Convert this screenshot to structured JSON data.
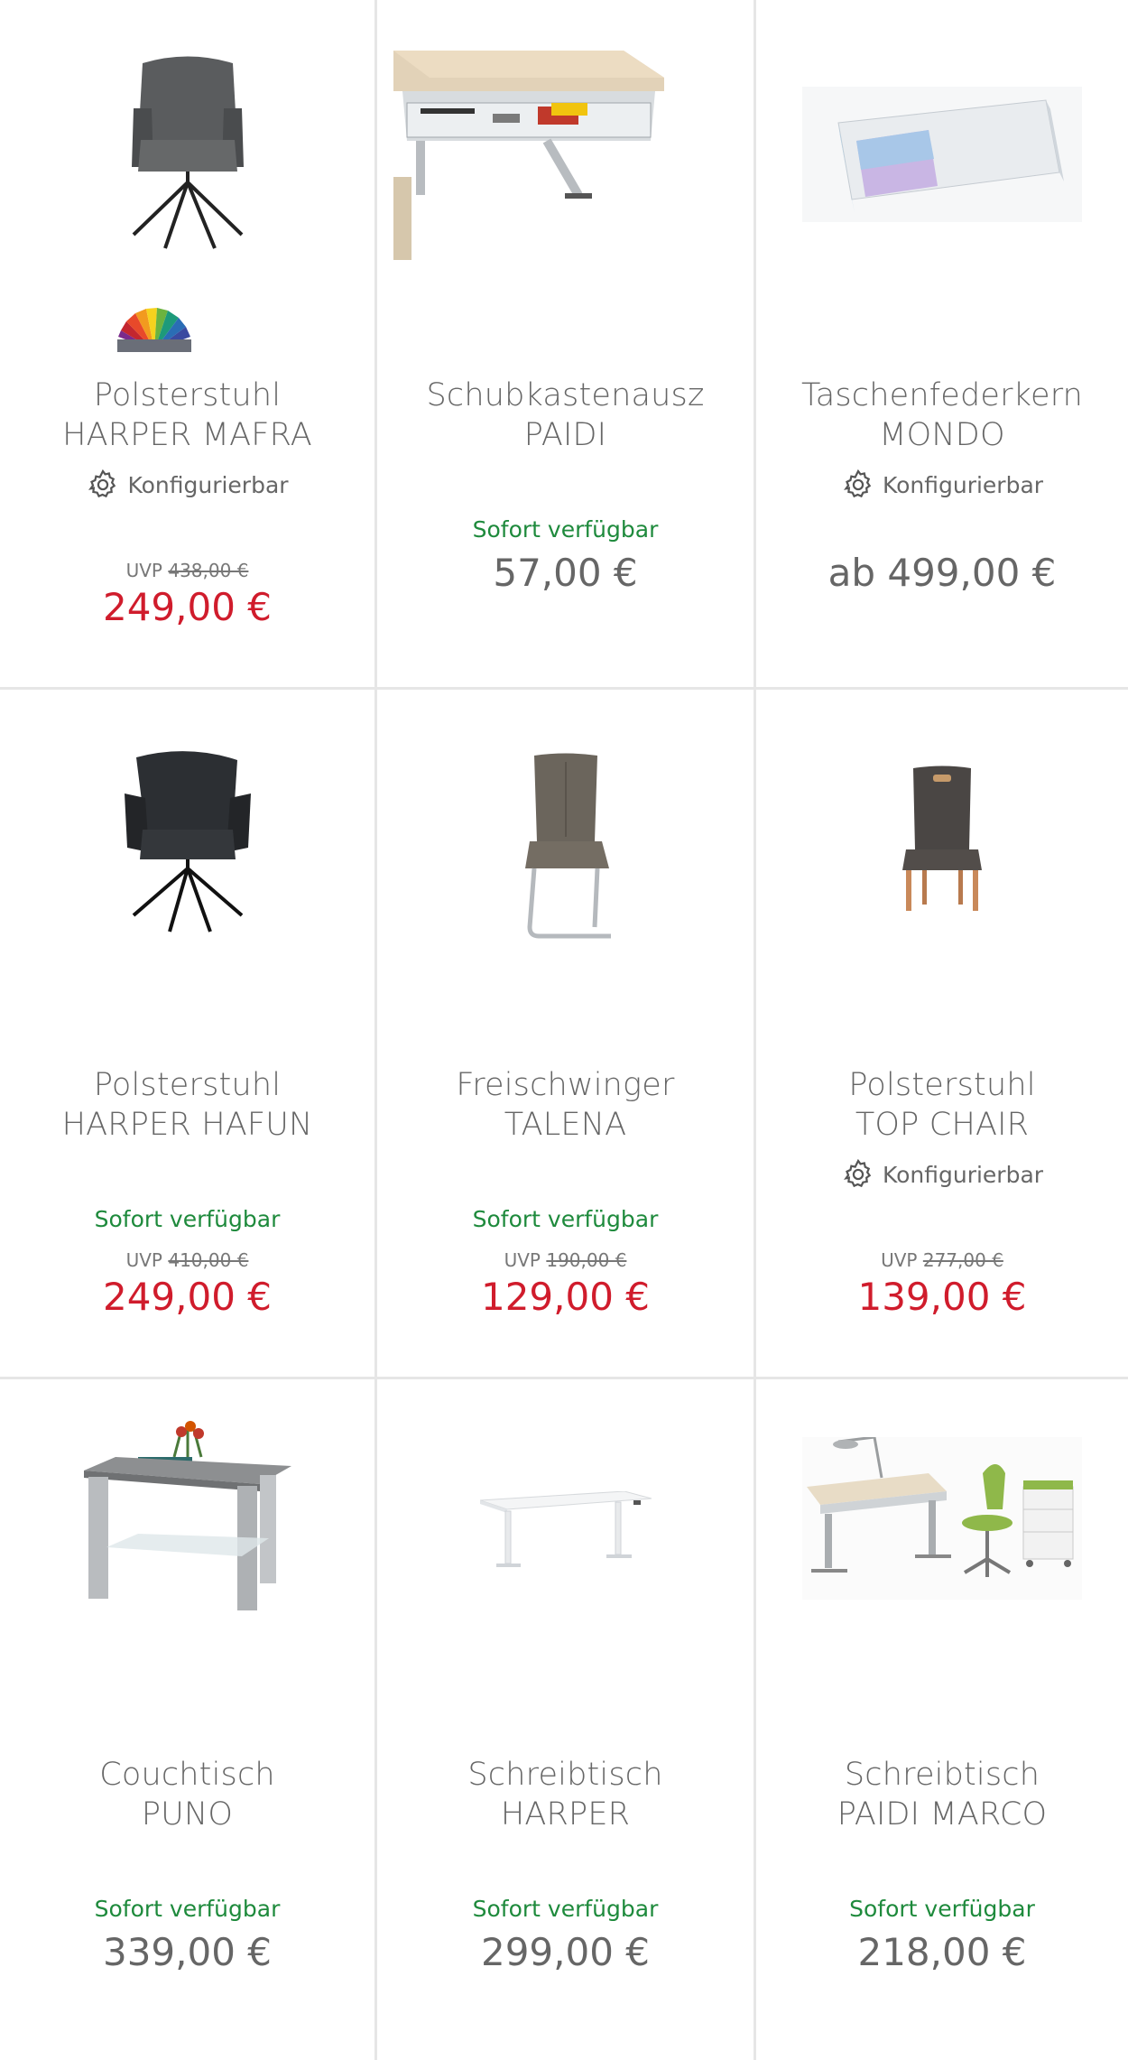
{
  "products": [
    {
      "title_line1": "Polsterstuhl",
      "title_line2": "HARPER MAFRA",
      "configurable_label": "Konfigurierbar",
      "availability": "",
      "uvp_label": "UVP",
      "uvp_price": "438,00 €",
      "price": "249,00 €",
      "image_icon": "armchair-grey-icon",
      "has_color_swatch": true
    },
    {
      "title_line1": "Schubkastenausz",
      "title_line2": "PAIDI",
      "configurable_label": "",
      "availability": "Sofort verfügbar",
      "uvp_label": "",
      "uvp_price": "",
      "price": "57,00 €",
      "image_icon": "desk-drawer-icon"
    },
    {
      "title_line1": "Taschenfederkern",
      "title_line2": "MONDO",
      "configurable_label": "Konfigurierbar",
      "availability": "",
      "uvp_label": "",
      "uvp_price": "",
      "price": "ab 499,00 €",
      "image_icon": "mattress-icon"
    },
    {
      "title_line1": "Polsterstuhl",
      "title_line2": "HARPER HAFUN",
      "configurable_label": "",
      "availability": "Sofort verfügbar",
      "uvp_label": "UVP",
      "uvp_price": "410,00 €",
      "price": "249,00 €",
      "image_icon": "armchair-black-icon"
    },
    {
      "title_line1": "Freischwinger",
      "title_line2": "TALENA",
      "configurable_label": "",
      "availability": "Sofort verfügbar",
      "uvp_label": "UVP",
      "uvp_price": "190,00 €",
      "price": "129,00 €",
      "image_icon": "cantilever-chair-icon"
    },
    {
      "title_line1": "Polsterstuhl",
      "title_line2": "TOP CHAIR",
      "configurable_label": "Konfigurierbar",
      "availability": "",
      "uvp_label": "UVP",
      "uvp_price": "277,00 €",
      "price": "139,00 €",
      "image_icon": "dining-chair-wood-icon"
    },
    {
      "title_line1": "Couchtisch",
      "title_line2": "PUNO",
      "configurable_label": "",
      "availability": "Sofort verfügbar",
      "uvp_label": "",
      "uvp_price": "",
      "price": "339,00 €",
      "image_icon": "coffee-table-icon"
    },
    {
      "title_line1": "Schreibtisch",
      "title_line2": "HARPER",
      "configurable_label": "",
      "availability": "Sofort verfügbar",
      "uvp_label": "",
      "uvp_price": "",
      "price": "299,00 €",
      "image_icon": "white-desk-icon"
    },
    {
      "title_line1": "Schreibtisch",
      "title_line2": "PAIDI MARCO",
      "configurable_label": "",
      "availability": "Sofort verfügbar",
      "uvp_label": "",
      "uvp_price": "",
      "price": "218,00 €",
      "image_icon": "kids-desk-set-icon"
    }
  ],
  "colors": {
    "sale_price": "#d01c2c",
    "availability": "#1e8a3c",
    "text": "#666666",
    "divider": "#e6e6e6"
  }
}
